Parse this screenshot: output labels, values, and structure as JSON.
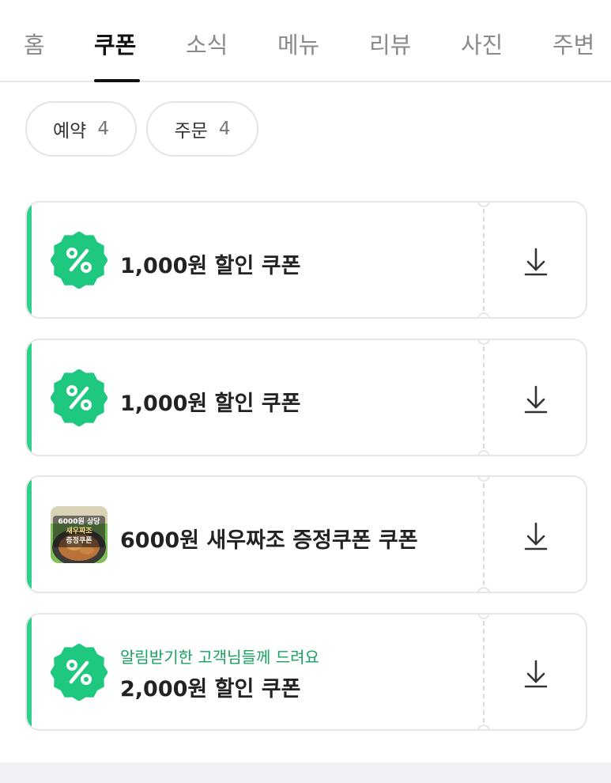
{
  "tabs": [
    {
      "label": "홈",
      "active": false
    },
    {
      "label": "쿠폰",
      "active": true
    },
    {
      "label": "소식",
      "active": false
    },
    {
      "label": "메뉴",
      "active": false
    },
    {
      "label": "리뷰",
      "active": false
    },
    {
      "label": "사진",
      "active": false
    },
    {
      "label": "주변",
      "active": false
    }
  ],
  "filters": [
    {
      "label": "예약",
      "count": "4"
    },
    {
      "label": "주문",
      "count": "4"
    }
  ],
  "colors": {
    "accent": "#2fcf8c",
    "badge": "#1fc87f",
    "subtitle": "#16a35f"
  },
  "coupons": [
    {
      "icon": "percent-icon",
      "title": "1,000원 할인 쿠폰",
      "subtitle": ""
    },
    {
      "icon": "percent-icon",
      "title": "1,000원 할인 쿠폰",
      "subtitle": ""
    },
    {
      "icon": "food-thumbnail",
      "title": "6000원 새우짜조 증정쿠폰 쿠폰",
      "subtitle": "",
      "thumb_text": [
        "6000원 상당",
        "새우짜조",
        "증정쿠폰"
      ]
    },
    {
      "icon": "percent-icon",
      "title": "2,000원 할인 쿠폰",
      "subtitle": "알림받기한 고객님들께 드려요"
    }
  ],
  "download_icon": "download-icon"
}
